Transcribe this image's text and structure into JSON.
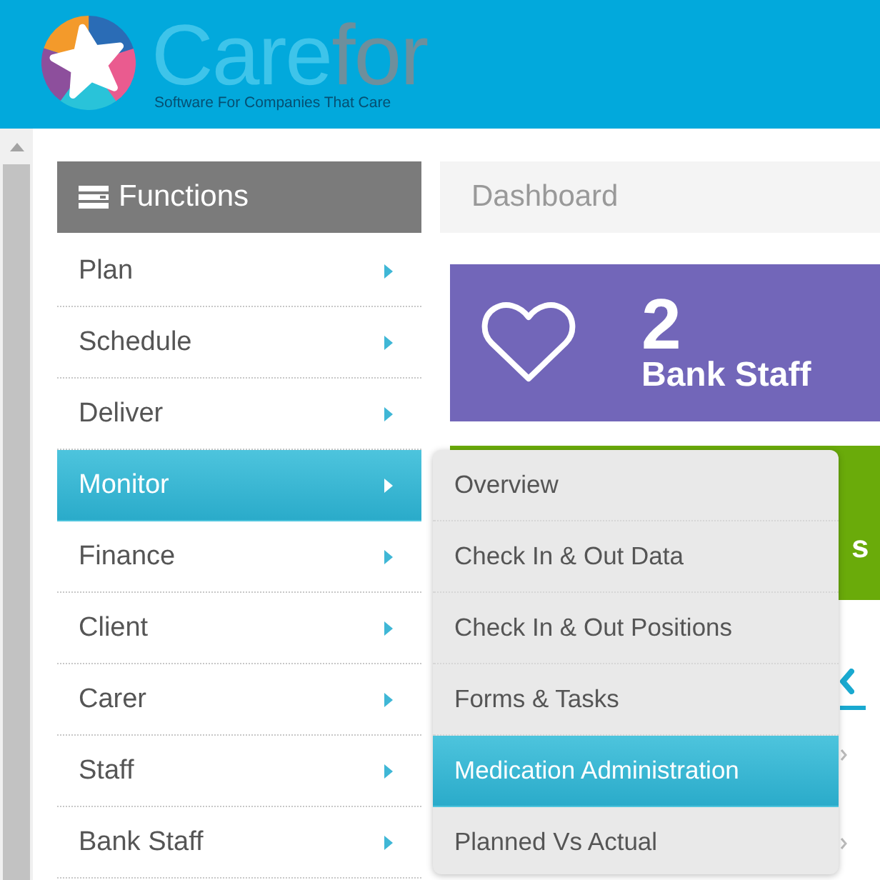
{
  "header": {
    "brand": {
      "name": "Care",
      "name_suffix": "for",
      "tagline": "Software For Companies That Care"
    }
  },
  "sidebar": {
    "title": "Functions",
    "items": [
      {
        "label": "Plan",
        "selected": false
      },
      {
        "label": "Schedule",
        "selected": false
      },
      {
        "label": "Deliver",
        "selected": false
      },
      {
        "label": "Monitor",
        "selected": true
      },
      {
        "label": "Finance",
        "selected": false
      },
      {
        "label": "Client",
        "selected": false
      },
      {
        "label": "Carer",
        "selected": false
      },
      {
        "label": "Staff",
        "selected": false
      },
      {
        "label": "Bank Staff",
        "selected": false
      }
    ]
  },
  "page_title": "Dashboard",
  "cards": [
    {
      "kind": "stat",
      "value": "2",
      "label": "Bank Staff",
      "color": "#7266b9"
    },
    {
      "kind": "partial",
      "text": "s",
      "color": "#6aab0a"
    }
  ],
  "submenu": {
    "items": [
      {
        "label": "Overview",
        "selected": false
      },
      {
        "label": "Check In & Out Data",
        "selected": false
      },
      {
        "label": "Check In & Out Positions",
        "selected": false
      },
      {
        "label": "Forms & Tasks",
        "selected": false
      },
      {
        "label": "Medication Administration",
        "selected": true
      },
      {
        "label": "Planned Vs Actual",
        "selected": false
      }
    ]
  }
}
